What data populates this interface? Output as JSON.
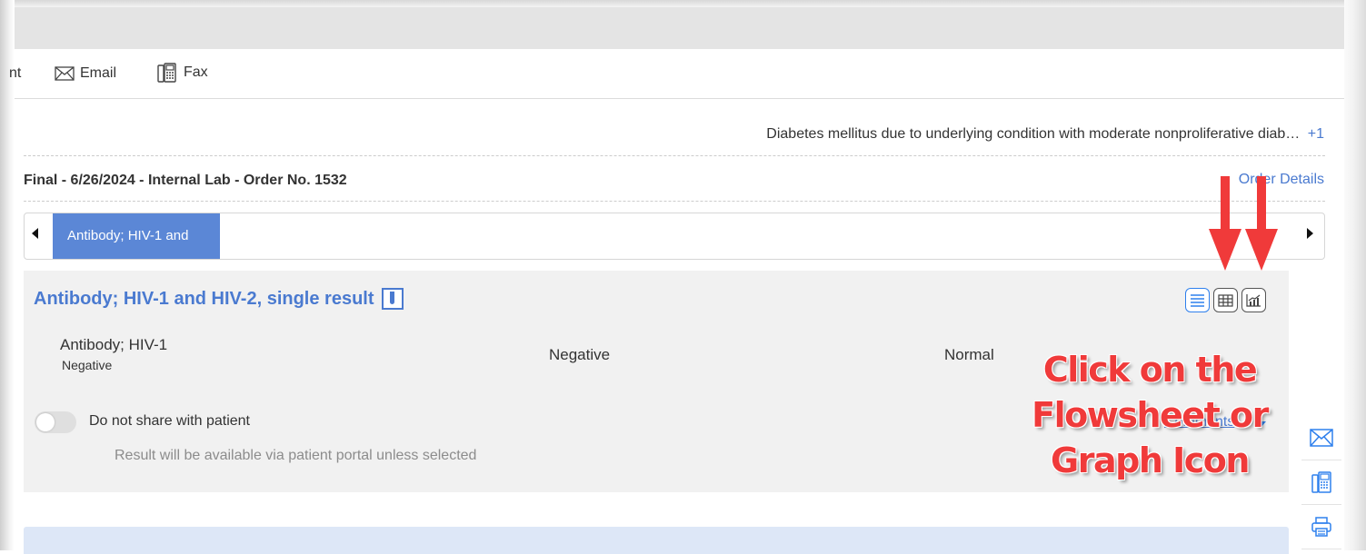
{
  "toolbar": {
    "print_partial": "nt",
    "email_label": "Email",
    "fax_label": "Fax"
  },
  "diagnosis": {
    "text": "Diabetes mellitus due to underlying condition with moderate nonproliferative diab…",
    "more": "+1"
  },
  "order": {
    "title": "Final - 6/26/2024 - Internal Lab - Order No. 1532",
    "details_link": "Order Details"
  },
  "tabs": {
    "active_label": "Antibody; HIV-1 and"
  },
  "panel": {
    "title": "Antibody; HIV-1 and HIV-2, single result",
    "result": {
      "name": "Antibody; HIV-1",
      "sub": "Negative",
      "value": "Negative",
      "flag": "Normal"
    },
    "share_toggle_label": "Do not share with patient",
    "share_help": "Result will be available via patient portal unless selected",
    "comments_link": "Comments"
  },
  "annotation": {
    "line1": "Click on the",
    "line2": "Flowsheet or",
    "line3": "Graph Icon"
  },
  "icons": {
    "email": "envelope-icon",
    "fax": "fax-icon",
    "list_view": "list-view-icon",
    "flowsheet": "flowsheet-icon",
    "graph": "graph-icon",
    "print": "printer-icon"
  },
  "colors": {
    "accent": "#5b87d6",
    "link": "#4a7ad0",
    "annotation": "#f03a3a",
    "panel_bg": "#f1f1f1"
  }
}
